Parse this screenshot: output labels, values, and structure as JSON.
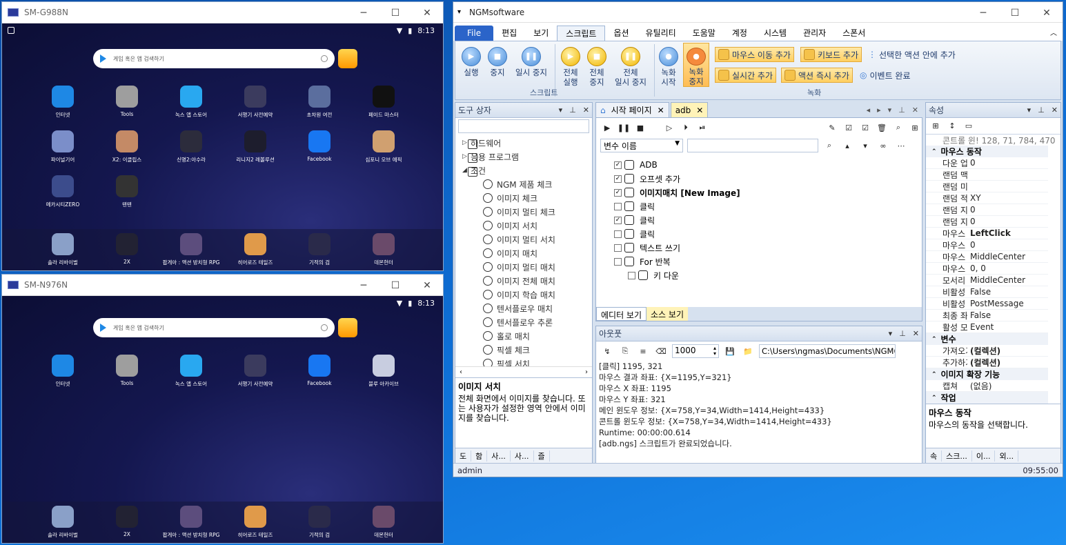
{
  "phone1": {
    "title": "SM-G988N",
    "time": "8:13",
    "search_placeholder": "게임 혹은 앱 검색하기",
    "apps": [
      {
        "label": "인터넷",
        "color": "#1e88e5"
      },
      {
        "label": "Tools",
        "color": "#9e9e9e"
      },
      {
        "label": "녹스 앱 스토어",
        "color": "#29a8f0"
      },
      {
        "label": "서행기 사전예약",
        "color": "#3b3b5e"
      },
      {
        "label": "초차원 여전",
        "color": "#5b6e9e"
      },
      {
        "label": "페이드 마스터",
        "color": "#111111"
      },
      {
        "label": "파이널기어",
        "color": "#7b8ec9"
      },
      {
        "label": "X2: 이클립스",
        "color": "#c48a66"
      },
      {
        "label": "신명2:아수라",
        "color": "#2c2c3c"
      },
      {
        "label": "리니지2 레볼루션",
        "color": "#1d1d2d"
      },
      {
        "label": "Facebook",
        "color": "#1877f2"
      },
      {
        "label": "심포니 오브 에픽",
        "color": "#d0a070"
      },
      {
        "label": "메카시티ZERO",
        "color": "#3c4c8c"
      },
      {
        "label": "텐텐",
        "color": "#333333"
      }
    ],
    "dock": [
      {
        "label": "솔라 리바이벌",
        "color": "#8aa0c8"
      },
      {
        "label": "2X",
        "color": "#222233"
      },
      {
        "label": "팝게아 : 액션 방치형 RPG",
        "color": "#5c4d7d"
      },
      {
        "label": "히어로즈 테일즈",
        "color": "#e09a4a"
      },
      {
        "label": "기적의 검",
        "color": "#2a2a4a"
      },
      {
        "label": "데몬헌터",
        "color": "#6a4a6a"
      }
    ]
  },
  "phone2": {
    "title": "SM-N976N",
    "time": "8:13",
    "search_placeholder": "게임 혹은 앱 검색하기",
    "apps": [
      {
        "label": "인터넷",
        "color": "#1e88e5"
      },
      {
        "label": "Tools",
        "color": "#9e9e9e"
      },
      {
        "label": "녹스 앱 스토어",
        "color": "#29a8f0"
      },
      {
        "label": "서행기 사전예약",
        "color": "#3b3b5e"
      },
      {
        "label": "Facebook",
        "color": "#1877f2"
      },
      {
        "label": "블루 아카이브",
        "color": "#c8cde0"
      }
    ],
    "dock": [
      {
        "label": "솔라 리바이벌",
        "color": "#8aa0c8"
      },
      {
        "label": "2X",
        "color": "#222233"
      },
      {
        "label": "팝게아 : 액션 방치형 RPG",
        "color": "#5c4d7d"
      },
      {
        "label": "히어로즈 테일즈",
        "color": "#e09a4a"
      },
      {
        "label": "기적의 검",
        "color": "#2a2a4a"
      },
      {
        "label": "데몬헌터",
        "color": "#6a4a6a"
      }
    ]
  },
  "ngm": {
    "title": "NGMsoftware",
    "menus": [
      "File",
      "편집",
      "보기",
      "스크립트",
      "옵션",
      "유틸리티",
      "도움말",
      "계정",
      "시스템",
      "관리자",
      "스폰서"
    ],
    "ribbon": {
      "script_buttons": [
        {
          "label": "실행",
          "icon": "▶"
        },
        {
          "label": "중지",
          "icon": "■"
        },
        {
          "label": "일시 중지",
          "icon": "❚❚"
        }
      ],
      "all_buttons": [
        {
          "label": "전체\n실행",
          "icon": "▶"
        },
        {
          "label": "전체\n중지",
          "icon": "■"
        },
        {
          "label": "전체\n일시 중지",
          "icon": "❚❚"
        }
      ],
      "group_script": "스크립트",
      "record_start": "녹화\n시작",
      "record_stop": "녹화\n중지",
      "mouse_move_add": "마우스 이동 추가",
      "keyboard_add": "키보드 추가",
      "selected_action_add": "선택한 액션 안에 추가",
      "realtime_add": "실시간 추가",
      "action_now_add": "액션 즉시 추가",
      "event_done": "이벤트 완료",
      "group_record": "녹화"
    },
    "toolbox": {
      "title": "도구 상자",
      "items": [
        {
          "label": "하드웨어",
          "level": 0
        },
        {
          "label": "응용 프로그램",
          "level": 0
        },
        {
          "label": "조건",
          "level": 0
        },
        {
          "label": "NGM 제품 체크",
          "level": 1
        },
        {
          "label": "이미지 체크",
          "level": 1
        },
        {
          "label": "이미지 멀티 체크",
          "level": 1
        },
        {
          "label": "이미지 서치",
          "level": 1
        },
        {
          "label": "이미지 멀티 서치",
          "level": 1
        },
        {
          "label": "이미지 매치",
          "level": 1
        },
        {
          "label": "이미지 멀티 매치",
          "level": 1
        },
        {
          "label": "이미지 전체 매치",
          "level": 1
        },
        {
          "label": "이미지 학습 매치",
          "level": 1
        },
        {
          "label": "텐서플로우 매치",
          "level": 1
        },
        {
          "label": "텐서플로우 추론",
          "level": 1
        },
        {
          "label": "홀로 매치",
          "level": 1
        },
        {
          "label": "픽셀 체크",
          "level": 1
        },
        {
          "label": "픽셀 서치",
          "level": 1
        }
      ],
      "desc_title": "이미지 서치",
      "desc_text": "전체 화면에서 이미지를 찾습니다. 또는 사용자가 설정한 영역 안에서 이미지를 찾습니다.",
      "bottom_tabs": [
        "도",
        "함",
        "사...",
        "사...",
        "즐"
      ]
    },
    "editor": {
      "tabs": [
        "시작 페이지",
        "adb"
      ],
      "var_placeholder": "변수 이름",
      "rows": [
        {
          "label": "ADB",
          "checked": true,
          "indent": 0,
          "bold": false
        },
        {
          "label": "오프셋 추가",
          "checked": true,
          "indent": 0,
          "bold": false
        },
        {
          "label": "이미지매치 [New Image]",
          "checked": true,
          "indent": 0,
          "bold": true
        },
        {
          "label": "클릭",
          "checked": false,
          "indent": 0,
          "bold": false
        },
        {
          "label": "클릭",
          "checked": true,
          "indent": 0,
          "bold": false
        },
        {
          "label": "클릭",
          "checked": false,
          "indent": 0,
          "bold": false
        },
        {
          "label": "텍스트 쓰기",
          "checked": false,
          "indent": 0,
          "bold": false
        },
        {
          "label": "For 반복",
          "checked": false,
          "indent": 0,
          "bold": false
        },
        {
          "label": "키 다운",
          "checked": false,
          "indent": 1,
          "bold": false
        }
      ],
      "view_editor": "에디터 보기",
      "view_source": "소스 보기"
    },
    "output": {
      "title": "아웃풋",
      "delay": "1000",
      "path": "C:\\Users\\ngmas\\Documents\\NGM6\\",
      "lines": [
        "[클릭] 1195, 321",
        "마우스 결과 좌표: {X=1195,Y=321}",
        "마우스 X 좌표: 1195",
        "마우스 Y 좌표: 321",
        "메인 윈도우 정보: {X=758,Y=34,Width=1414,Height=433}",
        "콘트롤 윈도우 정보: {X=758,Y=34,Width=1414,Height=433}",
        "Runtime: 00:00:00.614",
        "[adb.ngs] 스크립트가 완료되었습니다."
      ]
    },
    "props": {
      "title": "속성",
      "top_row": "콘트롤 윈! 128, 71, 784, 470",
      "rows": [
        {
          "type": "cat",
          "k": "마우스 동작"
        },
        {
          "type": "row",
          "k": "다운 업 지",
          "v": "0"
        },
        {
          "type": "row",
          "k": "랜덤 맥시!",
          "v": ""
        },
        {
          "type": "row",
          "k": "랜덤 미니!",
          "v": ""
        },
        {
          "type": "row",
          "k": "랜덤 적용",
          "v": "XY"
        },
        {
          "type": "row",
          "k": "랜덤 지연",
          "v": "0"
        },
        {
          "type": "row",
          "k": "랜덤 지연",
          "v": "0"
        },
        {
          "type": "row",
          "k": "마우스 동!",
          "v": "LeftClick",
          "bold": true
        },
        {
          "type": "row",
          "k": "마우스 실!",
          "v": "0"
        },
        {
          "type": "row",
          "k": "마우스 위!",
          "v": "MiddleCenter"
        },
        {
          "type": "row",
          "k": "마우스 절!",
          "v": "0, 0"
        },
        {
          "type": "row",
          "k": "모서리 위!",
          "v": "MiddleCenter"
        },
        {
          "type": "row",
          "k": "비활성 모!",
          "v": "False"
        },
        {
          "type": "row",
          "k": "비활성 모!",
          "v": "PostMessage"
        },
        {
          "type": "row",
          "k": "최종 좌표",
          "v": "False"
        },
        {
          "type": "row",
          "k": "활성 모드",
          "v": "Event"
        },
        {
          "type": "cat",
          "k": "변수"
        },
        {
          "type": "row",
          "k": "가져오기",
          "v": "(컬렉션)",
          "bold": true
        },
        {
          "type": "row",
          "k": "추가하기",
          "v": "(컬렉션)",
          "bold": true
        },
        {
          "type": "cat",
          "k": "이미지 확장 기능"
        },
        {
          "type": "row",
          "k": "캡쳐",
          "v": "(없음)"
        },
        {
          "type": "cat",
          "k": "작업"
        }
      ],
      "desc_title": "마우스 동작",
      "desc_text": "마우스의 동작을 선택합니다.",
      "bottom_tabs": [
        "속",
        "스크...",
        "이...",
        "외..."
      ]
    },
    "status_user": "admin",
    "status_time": "09:55:00"
  }
}
